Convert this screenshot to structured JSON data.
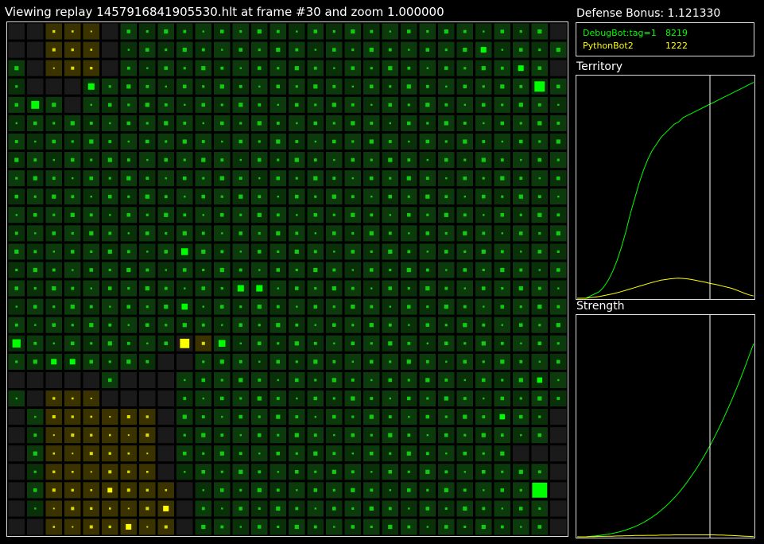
{
  "header": {
    "title": "Viewing replay 1457916841905530.hlt at frame #30 and zoom 1.000000"
  },
  "sidebar": {
    "defense_label": "Defense Bonus: 1.121330",
    "players": [
      {
        "name": "DebugBot:tag=1",
        "score": "8219",
        "color": "#00ff00"
      },
      {
        "name": "PythonBot2",
        "score": "1222",
        "color": "#ffff00"
      }
    ],
    "territory_title": "Territory",
    "strength_title": "Strength"
  },
  "board": {
    "cols": 30,
    "rows": 28,
    "map": [
      "..YYY.GGGGGGGGGGGGGGGGGGGGGGG.",
      "..YYY.GGGGGGGGGGGGGGGGGGGGGGGG",
      "G.YYY.GGGGGGGGGGGGGGGGGGGGGGG.",
      "G...GGGGGGGGGGGGGGGGGGGGGGGGGG",
      "GGG.GGGGGGGGGGGGGGGGGGGGGGGGGG",
      "GGGGGGGGGGGGGGGGGGGGGGGGGGGGGG",
      "GGGGGGGGGGGGGGGGGGGGGGGGGGGGGG",
      "GGGGGGGGGGGGGGGGGGGGGGGGGGGGGG",
      "GGGGGGGGGGGGGGGGGGGGGGGGGGGGGG",
      "GGGGGGGGGGGGGGGGGGGGGGGGGGGGGG",
      "GGGGGGGGGGGGGGGGGGGGGGGGGGGGGG",
      "GGGGGGGGGGGGGGGGGGGGGGGGGGGGGG",
      "GGGGGGGGGGGGGGGGGGGGGGGGGGGGGG",
      "GGGGGGGGGGGGGGGGGGGGGGGGGGGGGG",
      "GGGGGGGGGGGGGGGGGGGGGGGGGGGGGG",
      "GGGGGGGGGGGGGGGGGGGGGGGGGGGGGG",
      "GGGGGGGGGGGGGGGGGGGGGGGGGGGGGG",
      "GGGGGGGGG.YGGGGGGGGGGGGGGGGGGG",
      "GGGGGGGG..GGGGGGGGGGGGGGGGGGGG",
      ".....G...GGGGGGGGGGGGGGGGGGGGG",
      "G.YYY....GGGGGGGGGGGGGGGGGGGGG",
      ".GYYYYYY.GGGGGGGGGGGGGGGGGGGG.",
      ".GYYYYYY.GGGGGGGGGGGGGGGGGGGG.",
      ".GYYYYYY.GGGGGGGGGGGGGGGGGG...",
      ".GYYYYYY.GGGGGGGGGGGGGGGGGGGG.",
      ".GYYYYYYY.GGGGGGGGGGGGGGGGGG..",
      ".GYYYYYYY.GGGGGGGGGGGGGGGGGGG.",
      "..YYYYYYY.GGGGGGGGGGGGGGGGGGG."
    ],
    "big_pieces": [
      {
        "row": 4,
        "col": 1,
        "owner": "G",
        "strength": 0.42
      },
      {
        "row": 3,
        "col": 4,
        "owner": "G",
        "strength": 0.34
      },
      {
        "row": 3,
        "col": 28,
        "owner": "G",
        "strength": 0.55
      },
      {
        "row": 1,
        "col": 25,
        "owner": "G",
        "strength": 0.3
      },
      {
        "row": 2,
        "col": 27,
        "owner": "G",
        "strength": 0.3
      },
      {
        "row": 12,
        "col": 9,
        "owner": "G",
        "strength": 0.36
      },
      {
        "row": 14,
        "col": 12,
        "owner": "G",
        "strength": 0.34
      },
      {
        "row": 14,
        "col": 13,
        "owner": "G",
        "strength": 0.34
      },
      {
        "row": 15,
        "col": 9,
        "owner": "G",
        "strength": 0.32
      },
      {
        "row": 17,
        "col": 0,
        "owner": "G",
        "strength": 0.44
      },
      {
        "row": 17,
        "col": 9,
        "owner": "Y",
        "strength": 0.5
      },
      {
        "row": 17,
        "col": 11,
        "owner": "G",
        "strength": 0.36
      },
      {
        "row": 18,
        "col": 2,
        "owner": "G",
        "strength": 0.3
      },
      {
        "row": 18,
        "col": 3,
        "owner": "G",
        "strength": 0.3
      },
      {
        "row": 19,
        "col": 28,
        "owner": "G",
        "strength": 0.28
      },
      {
        "row": 21,
        "col": 26,
        "owner": "G",
        "strength": 0.28
      },
      {
        "row": 25,
        "col": 28,
        "owner": "G",
        "strength": 0.8
      },
      {
        "row": 26,
        "col": 8,
        "owner": "Y",
        "strength": 0.3
      },
      {
        "row": 27,
        "col": 6,
        "owner": "Y",
        "strength": 0.3
      },
      {
        "row": 25,
        "col": 5,
        "owner": "Y",
        "strength": 0.25
      }
    ]
  },
  "chart_data": [
    {
      "type": "line",
      "title": "Territory",
      "cursor_frame": 30,
      "frames": 40,
      "series": [
        {
          "name": "DebugBot:tag=1",
          "color": "#00ff00",
          "values": [
            0.0,
            0.0,
            0.0,
            0.01,
            0.02,
            0.03,
            0.05,
            0.08,
            0.12,
            0.17,
            0.23,
            0.3,
            0.38,
            0.45,
            0.52,
            0.58,
            0.63,
            0.67,
            0.7,
            0.73,
            0.75,
            0.77,
            0.79,
            0.8,
            0.82,
            0.83,
            0.84,
            0.85,
            0.86,
            0.87,
            0.88,
            0.89,
            0.9,
            0.91,
            0.92,
            0.93,
            0.94,
            0.95,
            0.96,
            0.97,
            0.98
          ]
        },
        {
          "name": "PythonBot2",
          "color": "#ffff00",
          "values": [
            0.0,
            0.0,
            0.0,
            0.003,
            0.005,
            0.008,
            0.012,
            0.016,
            0.02,
            0.025,
            0.03,
            0.036,
            0.042,
            0.048,
            0.054,
            0.06,
            0.066,
            0.072,
            0.077,
            0.082,
            0.085,
            0.088,
            0.09,
            0.091,
            0.09,
            0.088,
            0.085,
            0.081,
            0.077,
            0.073,
            0.068,
            0.064,
            0.06,
            0.055,
            0.05,
            0.045,
            0.038,
            0.03,
            0.022,
            0.015,
            0.01
          ]
        }
      ]
    },
    {
      "type": "line",
      "title": "Strength",
      "cursor_frame": 30,
      "frames": 40,
      "series": [
        {
          "name": "DebugBot:tag=1",
          "color": "#00ff00",
          "values": [
            0.0,
            0.0,
            0.0,
            0.002,
            0.004,
            0.006,
            0.009,
            0.012,
            0.016,
            0.02,
            0.025,
            0.031,
            0.038,
            0.046,
            0.055,
            0.065,
            0.077,
            0.09,
            0.104,
            0.12,
            0.138,
            0.157,
            0.178,
            0.2,
            0.225,
            0.252,
            0.28,
            0.31,
            0.342,
            0.376,
            0.412,
            0.45,
            0.49,
            0.532,
            0.576,
            0.622,
            0.67,
            0.72,
            0.772,
            0.826,
            0.88
          ]
        },
        {
          "name": "PythonBot2",
          "color": "#ffff00",
          "values": [
            0.0,
            0.0,
            0.0,
            0.001,
            0.001,
            0.002,
            0.002,
            0.003,
            0.003,
            0.004,
            0.004,
            0.005,
            0.005,
            0.006,
            0.006,
            0.006,
            0.007,
            0.007,
            0.007,
            0.008,
            0.008,
            0.008,
            0.009,
            0.009,
            0.009,
            0.009,
            0.009,
            0.009,
            0.009,
            0.009,
            0.009,
            0.009,
            0.008,
            0.008,
            0.007,
            0.006,
            0.005,
            0.004,
            0.003,
            0.002,
            0.001
          ]
        }
      ]
    }
  ]
}
